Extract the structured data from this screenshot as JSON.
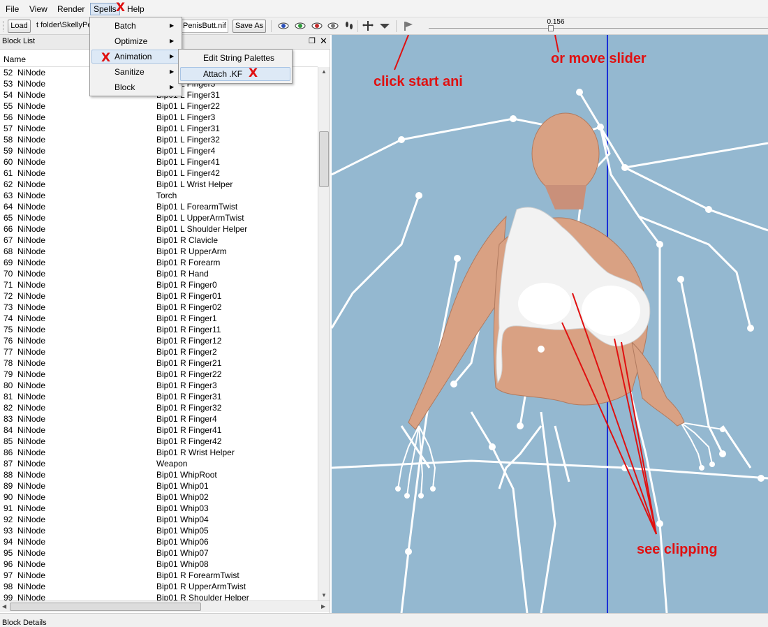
{
  "menubar": {
    "items": [
      "File",
      "View",
      "Render",
      "Spells",
      "Help"
    ]
  },
  "toolbar": {
    "load_label": "Load",
    "load_path": "t folder\\SkellyPe",
    "save_path": "PenisButt.nif",
    "save_as_label": "Save As",
    "slider_value": "0.156",
    "slider_position": 0.36
  },
  "spells_menu": {
    "items": [
      "Batch",
      "Optimize",
      "Animation",
      "Sanitize",
      "Block"
    ]
  },
  "animation_submenu": {
    "items": [
      "Edit String Palettes",
      "Attach .KF"
    ]
  },
  "block_list": {
    "title": "Block List",
    "column_name": "Name",
    "rows": [
      {
        "num": "52",
        "type": "NiNode",
        "name": "Bip01 L Finger2"
      },
      {
        "num": "53",
        "type": "NiNode",
        "name": "Bip01 L Finger3"
      },
      {
        "num": "54",
        "type": "NiNode",
        "name": "Bip01 L Finger31"
      },
      {
        "num": "55",
        "type": "NiNode",
        "name": "Bip01 L Finger22"
      },
      {
        "num": "56",
        "type": "NiNode",
        "name": "Bip01 L Finger3"
      },
      {
        "num": "57",
        "type": "NiNode",
        "name": "Bip01 L Finger31"
      },
      {
        "num": "58",
        "type": "NiNode",
        "name": "Bip01 L Finger32"
      },
      {
        "num": "59",
        "type": "NiNode",
        "name": "Bip01 L Finger4"
      },
      {
        "num": "60",
        "type": "NiNode",
        "name": "Bip01 L Finger41"
      },
      {
        "num": "61",
        "type": "NiNode",
        "name": "Bip01 L Finger42"
      },
      {
        "num": "62",
        "type": "NiNode",
        "name": "Bip01 L Wrist Helper"
      },
      {
        "num": "63",
        "type": "NiNode",
        "name": "Torch"
      },
      {
        "num": "64",
        "type": "NiNode",
        "name": "Bip01 L ForearmTwist"
      },
      {
        "num": "65",
        "type": "NiNode",
        "name": "Bip01 L UpperArmTwist"
      },
      {
        "num": "66",
        "type": "NiNode",
        "name": "Bip01 L Shoulder Helper"
      },
      {
        "num": "67",
        "type": "NiNode",
        "name": "Bip01 R Clavicle"
      },
      {
        "num": "68",
        "type": "NiNode",
        "name": "Bip01 R UpperArm"
      },
      {
        "num": "69",
        "type": "NiNode",
        "name": "Bip01 R Forearm"
      },
      {
        "num": "70",
        "type": "NiNode",
        "name": "Bip01 R Hand"
      },
      {
        "num": "71",
        "type": "NiNode",
        "name": "Bip01 R Finger0"
      },
      {
        "num": "72",
        "type": "NiNode",
        "name": "Bip01 R Finger01"
      },
      {
        "num": "73",
        "type": "NiNode",
        "name": "Bip01 R Finger02"
      },
      {
        "num": "74",
        "type": "NiNode",
        "name": "Bip01 R Finger1"
      },
      {
        "num": "75",
        "type": "NiNode",
        "name": "Bip01 R Finger11"
      },
      {
        "num": "76",
        "type": "NiNode",
        "name": "Bip01 R Finger12"
      },
      {
        "num": "77",
        "type": "NiNode",
        "name": "Bip01 R Finger2"
      },
      {
        "num": "78",
        "type": "NiNode",
        "name": "Bip01 R Finger21"
      },
      {
        "num": "79",
        "type": "NiNode",
        "name": "Bip01 R Finger22"
      },
      {
        "num": "80",
        "type": "NiNode",
        "name": "Bip01 R Finger3"
      },
      {
        "num": "81",
        "type": "NiNode",
        "name": "Bip01 R Finger31"
      },
      {
        "num": "82",
        "type": "NiNode",
        "name": "Bip01 R Finger32"
      },
      {
        "num": "83",
        "type": "NiNode",
        "name": "Bip01 R Finger4"
      },
      {
        "num": "84",
        "type": "NiNode",
        "name": "Bip01 R Finger41"
      },
      {
        "num": "85",
        "type": "NiNode",
        "name": "Bip01 R Finger42"
      },
      {
        "num": "86",
        "type": "NiNode",
        "name": "Bip01 R Wrist Helper"
      },
      {
        "num": "87",
        "type": "NiNode",
        "name": "Weapon"
      },
      {
        "num": "88",
        "type": "NiNode",
        "name": "Bip01 WhipRoot"
      },
      {
        "num": "89",
        "type": "NiNode",
        "name": "Bip01 Whip01"
      },
      {
        "num": "90",
        "type": "NiNode",
        "name": "Bip01 Whip02"
      },
      {
        "num": "91",
        "type": "NiNode",
        "name": "Bip01 Whip03"
      },
      {
        "num": "92",
        "type": "NiNode",
        "name": "Bip01 Whip04"
      },
      {
        "num": "93",
        "type": "NiNode",
        "name": "Bip01 Whip05"
      },
      {
        "num": "94",
        "type": "NiNode",
        "name": "Bip01 Whip06"
      },
      {
        "num": "95",
        "type": "NiNode",
        "name": "Bip01 Whip07"
      },
      {
        "num": "96",
        "type": "NiNode",
        "name": "Bip01 Whip08"
      },
      {
        "num": "97",
        "type": "NiNode",
        "name": "Bip01 R ForearmTwist"
      },
      {
        "num": "98",
        "type": "NiNode",
        "name": "Bip01 R UpperArmTwist"
      },
      {
        "num": "99",
        "type": "NiNode",
        "name": "Bip01 R Shoulder Helper"
      }
    ]
  },
  "annotations": {
    "mark": "X",
    "click_start": "click start ani",
    "move_slider": "or move slider",
    "clipping": "see clipping",
    "color": "#e01010"
  },
  "status": {
    "block_details": "Block Details"
  },
  "colors": {
    "viewport_bg": "#94b8d0",
    "axis_line": "#1a2fd6",
    "skin": "#d9a183",
    "cloth": "#f2f2f2"
  }
}
